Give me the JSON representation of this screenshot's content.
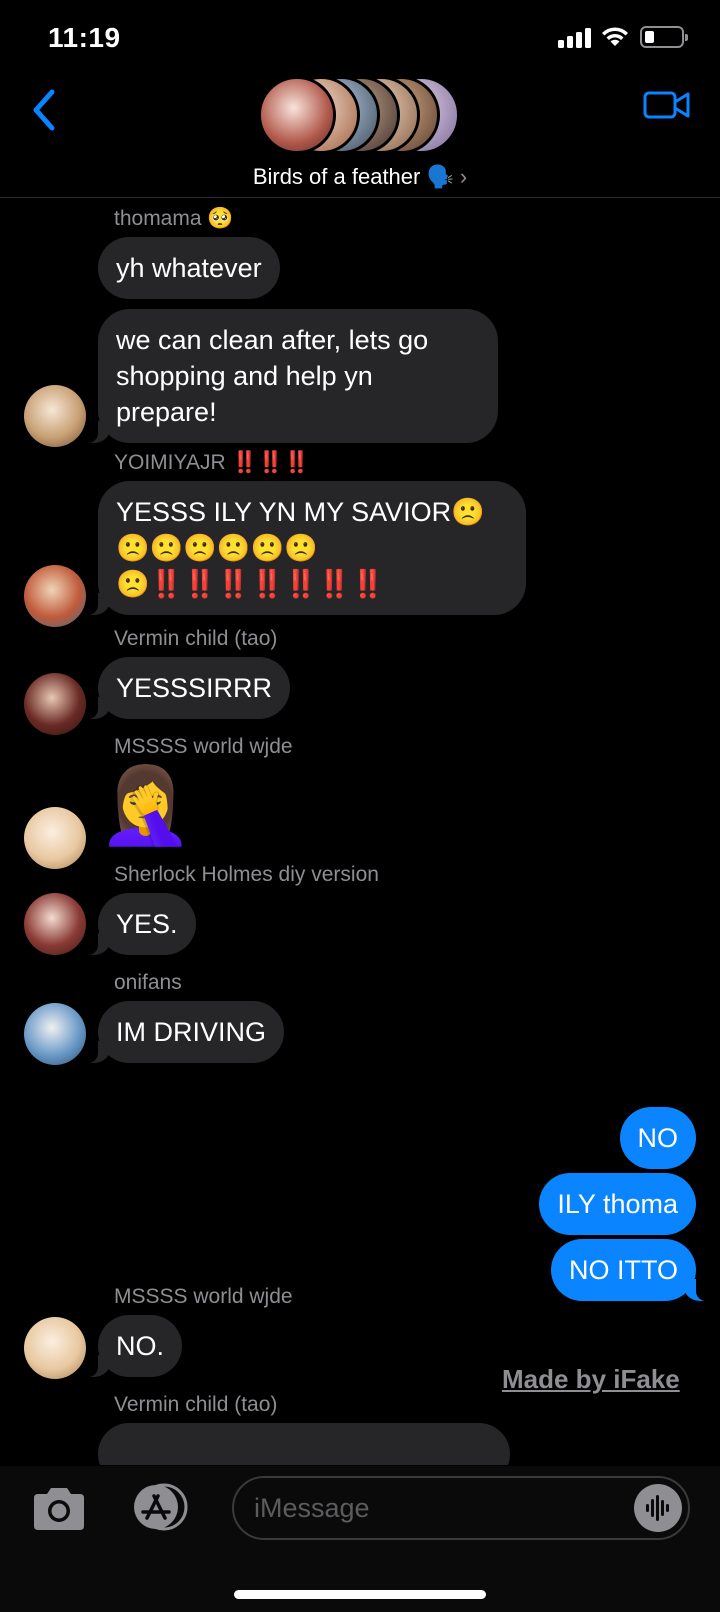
{
  "status": {
    "time": "11:19"
  },
  "header": {
    "title": "Birds of a feather 🗣️",
    "chevron": "›"
  },
  "messages": [
    {
      "sender": "thomama 🥺",
      "text": "yh whatever"
    },
    {
      "text": "we can clean after, lets go shopping and help yn prepare!"
    },
    {
      "sender": "YOIMIYAJR",
      "sender_emoji": "‼️‼️‼️",
      "text": "YESSS ILY YN MY SAVIOR🙁🙁🙁🙁🙁🙁🙁🙁",
      "text_emoji": "‼️‼️‼️‼️‼️‼️‼️"
    },
    {
      "sender": "Vermin child (tao)",
      "text": "YESSSIRRR"
    },
    {
      "sender": "MSSSS world wjde",
      "text": "🤦‍♀️"
    },
    {
      "sender": "Sherlock Holmes diy version",
      "text": "YES."
    },
    {
      "sender": "onifans",
      "text": "IM DRIVING"
    },
    {
      "text": "NO"
    },
    {
      "text": "ILY thoma"
    },
    {
      "text": "NO ITTO"
    },
    {
      "sender": "MSSSS world wjde",
      "text": "NO."
    },
    {
      "sender": "Vermin child (tao)"
    }
  ],
  "watermark": "Made by iFake",
  "input": {
    "placeholder": "iMessage"
  },
  "icons": {
    "back": "chevron-left-icon",
    "video": "video-camera-icon",
    "camera": "camera-icon",
    "apps": "app-store-icon",
    "audio": "audio-waveform-icon"
  },
  "colors": {
    "accent": "#0a84ff",
    "incoming_bubble": "#262628",
    "background": "#000000",
    "secondary_text": "#8e8e93"
  }
}
